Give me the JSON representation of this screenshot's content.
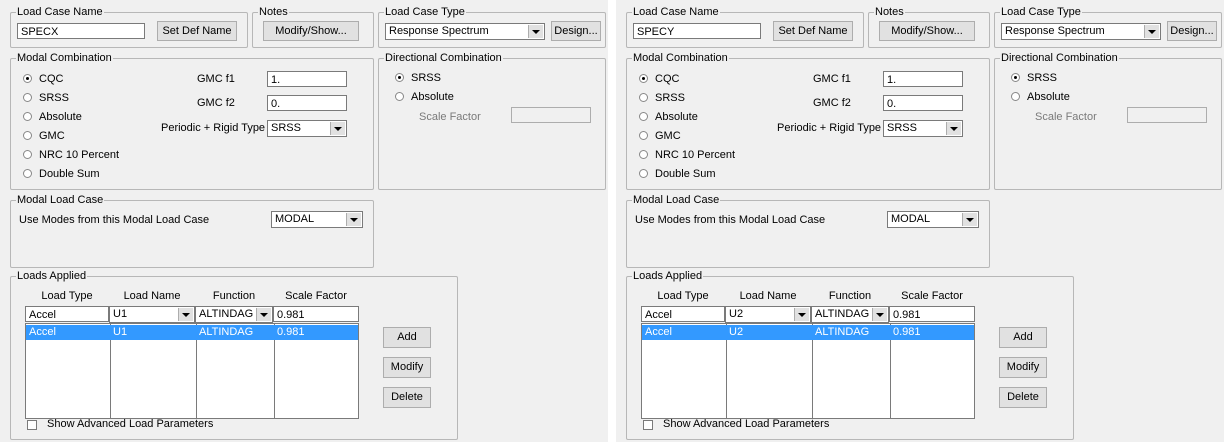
{
  "panels": [
    {
      "load_case_name": {
        "title": "Load Case Name",
        "value": "SPECX",
        "set_def_button": "Set Def Name"
      },
      "notes": {
        "title": "Notes",
        "button": "Modify/Show..."
      },
      "load_case_type": {
        "title": "Load Case Type",
        "value": "Response Spectrum",
        "design_button": "Design..."
      },
      "modal_combination": {
        "title": "Modal Combination",
        "options": [
          "CQC",
          "SRSS",
          "Absolute",
          "GMC",
          "NRC 10 Percent",
          "Double Sum"
        ],
        "selected": "CQC",
        "gmc_f1_label": "GMC  f1",
        "gmc_f1_value": "1.",
        "gmc_f2_label": "GMC  f2",
        "gmc_f2_value": "0.",
        "periodic_label": "Periodic + Rigid Type",
        "periodic_value": "SRSS"
      },
      "directional_combination": {
        "title": "Directional Combination",
        "options": [
          "SRSS",
          "Absolute"
        ],
        "selected": "SRSS",
        "scale_factor_label": "Scale Factor",
        "scale_factor_value": ""
      },
      "modal_load_case": {
        "title": "Modal Load Case",
        "label": "Use Modes from this Modal Load Case",
        "value": "MODAL"
      },
      "loads_applied": {
        "title": "Loads Applied",
        "headers": [
          "Load Type",
          "Load Name",
          "Function",
          "Scale Factor"
        ],
        "edit_row": [
          "Accel",
          "U1",
          "ALTINDAG",
          "0.981"
        ],
        "rows": [
          [
            "Accel",
            "U1",
            "ALTINDAG",
            "0.981"
          ]
        ],
        "buttons": [
          "Add",
          "Modify",
          "Delete"
        ],
        "advanced_label": "Show Advanced Load Parameters"
      }
    },
    {
      "load_case_name": {
        "title": "Load Case Name",
        "value": "SPECY",
        "set_def_button": "Set Def Name"
      },
      "notes": {
        "title": "Notes",
        "button": "Modify/Show..."
      },
      "load_case_type": {
        "title": "Load Case Type",
        "value": "Response Spectrum",
        "design_button": "Design..."
      },
      "modal_combination": {
        "title": "Modal Combination",
        "options": [
          "CQC",
          "SRSS",
          "Absolute",
          "GMC",
          "NRC 10 Percent",
          "Double Sum"
        ],
        "selected": "CQC",
        "gmc_f1_label": "GMC  f1",
        "gmc_f1_value": "1.",
        "gmc_f2_label": "GMC  f2",
        "gmc_f2_value": "0.",
        "periodic_label": "Periodic + Rigid Type",
        "periodic_value": "SRSS"
      },
      "directional_combination": {
        "title": "Directional Combination",
        "options": [
          "SRSS",
          "Absolute"
        ],
        "selected": "SRSS",
        "scale_factor_label": "Scale Factor",
        "scale_factor_value": ""
      },
      "modal_load_case": {
        "title": "Modal Load Case",
        "label": "Use Modes from this Modal Load Case",
        "value": "MODAL"
      },
      "loads_applied": {
        "title": "Loads Applied",
        "headers": [
          "Load Type",
          "Load Name",
          "Function",
          "Scale Factor"
        ],
        "edit_row": [
          "Accel",
          "U2",
          "ALTINDAG",
          "0.981"
        ],
        "rows": [
          [
            "Accel",
            "U2",
            "ALTINDAG",
            "0.981"
          ]
        ],
        "buttons": [
          "Add",
          "Modify",
          "Delete"
        ],
        "advanced_label": "Show Advanced Load Parameters"
      }
    }
  ]
}
